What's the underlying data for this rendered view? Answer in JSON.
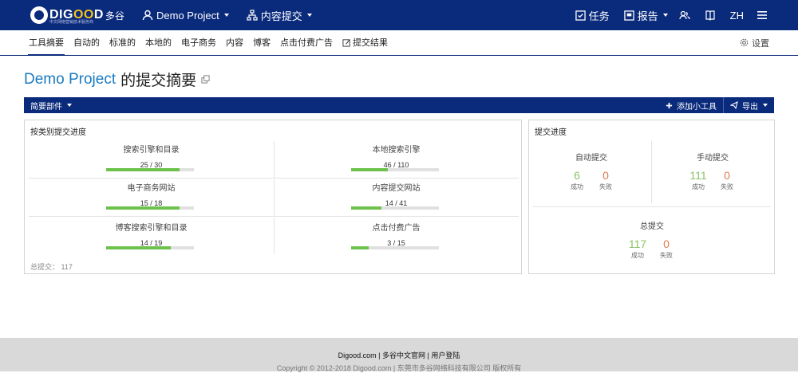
{
  "topbar": {
    "logo_text_prefix": "DIG",
    "logo_text_oo": "OO",
    "logo_text_suffix": "D",
    "logo_cn": "多谷",
    "logo_sub": "中文网络营销技术服务商",
    "project_label": "Demo Project",
    "section_label": "内容提交",
    "tasks_label": "任务",
    "reports_label": "报告",
    "lang_label": "ZH"
  },
  "subnav": {
    "tabs": [
      "工具摘要",
      "自动的",
      "标准的",
      "本地的",
      "电子商务",
      "内容",
      "博客",
      "点击付费广告",
      "提交结果"
    ],
    "settings_label": "设置"
  },
  "page": {
    "title_project": "Demo Project",
    "title_rest": "的提交摘要"
  },
  "widgetbar": {
    "summary_label": "简要部件",
    "add_widget_label": "添加小工具",
    "export_label": "导出"
  },
  "progress_panel": {
    "title": "按类别提交进度",
    "items": [
      {
        "name": "搜索引擎和目录",
        "count": "25 / 30",
        "progress": 0.833
      },
      {
        "name": "本地搜索引擎",
        "count": "46 / 110",
        "progress": 0.418
      },
      {
        "name": "电子商务网站",
        "count": "15 / 18",
        "progress": 0.833
      },
      {
        "name": "内容提交网站",
        "count": "14 / 41",
        "progress": 0.341
      },
      {
        "name": "博客搜索引擎和目录",
        "count": "14 / 19",
        "progress": 0.737
      },
      {
        "name": "点击付费广告",
        "count": "3 / 15",
        "progress": 0.2
      }
    ],
    "total_label": "总提交： 117"
  },
  "submit_panel": {
    "title": "提交进度",
    "auto": {
      "label": "自动提交",
      "success": "6",
      "fail": "0"
    },
    "manual": {
      "label": "手动提交",
      "success": "111",
      "fail": "0"
    },
    "total": {
      "label": "总提交",
      "success": "117",
      "fail": "0"
    },
    "success_label": "成功",
    "fail_label": "失败"
  },
  "footer": {
    "links": "Digood.com | 多谷中文官网 | 用户登陆",
    "copyright": "Copyright © 2012-2018 Digood.com | 东莞市多谷网络科技有限公司 版权所有"
  },
  "colors": {
    "brand": "#0a2a7c",
    "progress_fill": "#6cc24a",
    "success": "#8cc266",
    "fail": "#e07a4f",
    "title_link": "#1a7bc0"
  }
}
